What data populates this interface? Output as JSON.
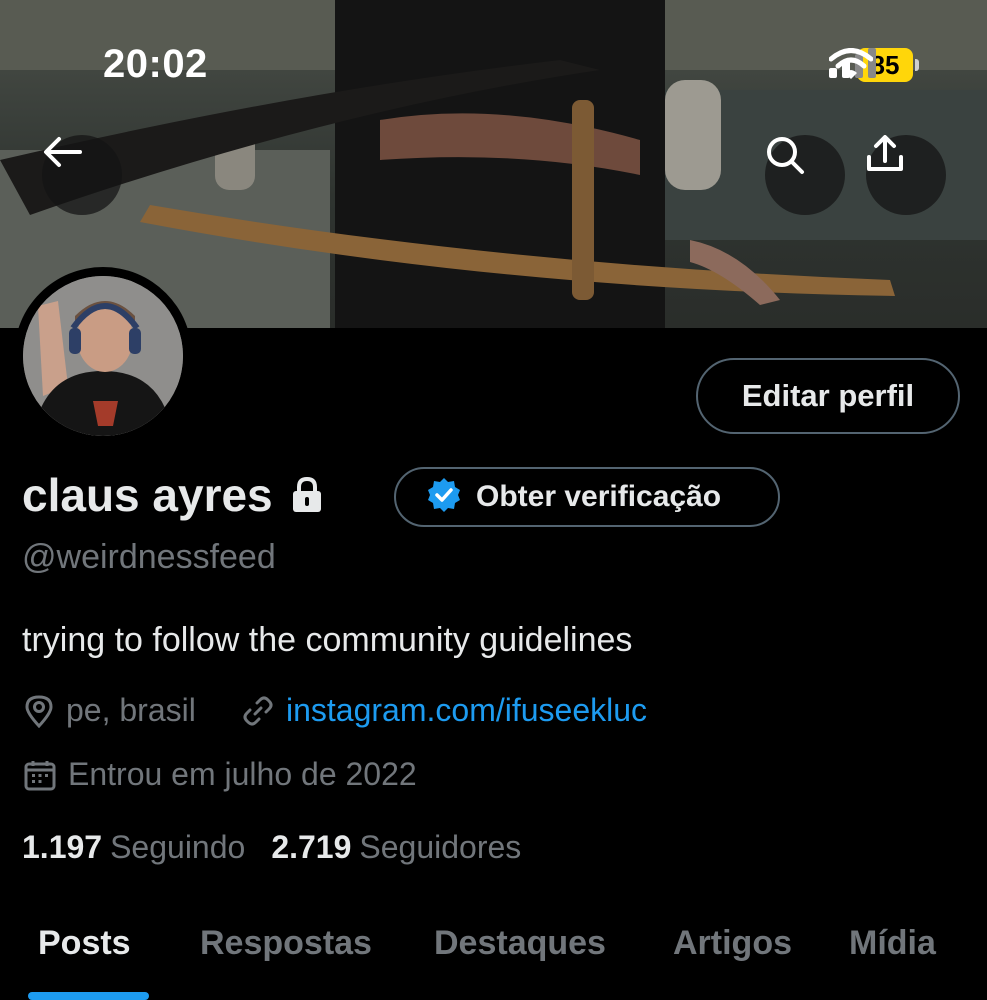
{
  "status_bar": {
    "time": "20:02",
    "battery": "85",
    "icons": [
      "signal-icon",
      "wifi-icon",
      "battery-icon"
    ]
  },
  "header": {
    "icons": [
      "back-arrow-icon",
      "search-icon",
      "share-icon"
    ]
  },
  "profile": {
    "edit_label": "Editar perfil",
    "name": "claus ayres",
    "verify_label": "Obter verificação",
    "handle": "@weirdnessfeed",
    "bio": "trying to follow the community guidelines",
    "location": "pe, brasil",
    "link": "instagram.com/ifuseekluc",
    "joined": "Entrou em julho de 2022",
    "following_count": "1.197",
    "following_label": "Seguindo",
    "followers_count": "2.719",
    "followers_label": "Seguidores"
  },
  "tabs": [
    {
      "label": "Posts",
      "active": true
    },
    {
      "label": "Respostas",
      "active": false
    },
    {
      "label": "Destaques",
      "active": false
    },
    {
      "label": "Artigos",
      "active": false
    },
    {
      "label": "Mídia",
      "active": false
    }
  ],
  "colors": {
    "background": "#000000",
    "accent": "#1d9bf0",
    "secondary_text": "#71767b",
    "primary_text": "#e7e9ea",
    "battery": "#ffd60a"
  }
}
